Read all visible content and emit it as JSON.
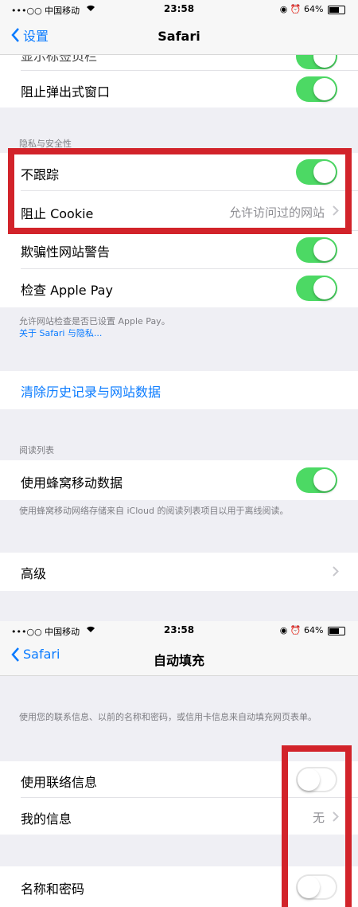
{
  "screen1": {
    "status": {
      "carrier": "•••○○ 中国移动",
      "time": "23:58",
      "battery": "64%",
      "battery_level": 0.64
    },
    "nav": {
      "back_label": "设置",
      "title": "Safari"
    },
    "rows": {
      "partial_label": "显示标签页栏",
      "block_popups": "阻止弹出式窗口",
      "dnt": "不跟踪",
      "block_cookie": "阻止 Cookie",
      "block_cookie_value": "允许访问过的网站",
      "fraud_warning": "欺骗性网站警告",
      "check_applepay": "检查 Apple Pay",
      "clear_history": "清除历史记录与网站数据",
      "cellular_data": "使用蜂窝移动数据",
      "advanced": "高级"
    },
    "headers": {
      "privacy": "隐私与安全性",
      "reading_list": "阅读列表"
    },
    "footers": {
      "applepay_note": "允许网站检查是否已设置 Apple Pay。",
      "about_link": "关于 Safari 与隐私...",
      "reading_note": "使用蜂窝移动网络存储来自 iCloud 的阅读列表项目以用于离线阅读。"
    },
    "colors": {
      "accent": "#0a7bff",
      "toggle_on": "#4cd964",
      "highlight": "#d2232a"
    }
  },
  "screen2": {
    "status": {
      "carrier": "•••○○ 中国移动",
      "time": "23:58",
      "battery": "64%",
      "battery_level": 0.64
    },
    "nav": {
      "back_label": "Safari",
      "title": "自动填充"
    },
    "note": "使用您的联系信息、以前的名称和密码，或信用卡信息来自动填充网页表单。",
    "rows": {
      "use_contact": "使用联络信息",
      "my_info": "我的信息",
      "my_info_value": "无",
      "names_passwords": "名称和密码"
    }
  }
}
